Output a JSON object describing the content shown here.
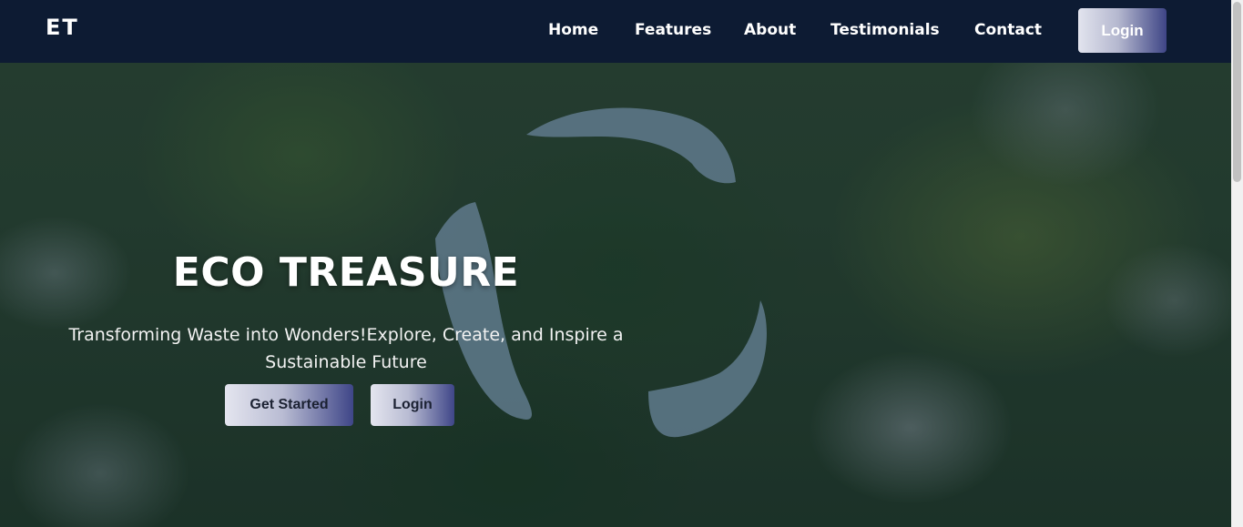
{
  "nav": {
    "logo": "ET",
    "links": [
      "Home",
      "Features",
      "About",
      "Testimonials",
      "Contact"
    ],
    "login_label": "Login"
  },
  "hero": {
    "title": "ECO TREASURE",
    "subtitle": "Transforming Waste into Wonders!Explore, Create, and Inspire a Sustainable Future",
    "get_started_label": "Get Started",
    "login_label": "Login"
  },
  "colors": {
    "navbar": "#0d1b33",
    "button_gradient_end": "#3e4586",
    "hero_text": "#ffffff"
  }
}
